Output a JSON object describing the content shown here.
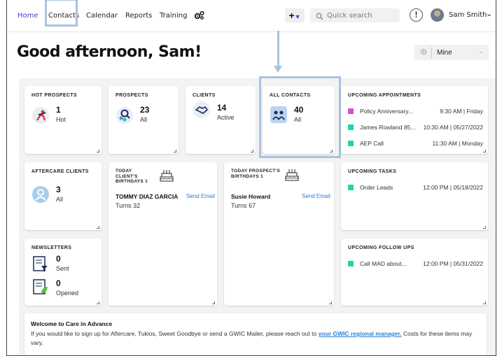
{
  "nav": {
    "items": [
      "Home",
      "Contacts",
      "Calendar",
      "Reports",
      "Training"
    ],
    "active": "Home",
    "quick_add": "+",
    "search_placeholder": "Quick search",
    "user_name": "Sam Smith",
    "accent_color": "#4a3fd1"
  },
  "greeting": "Good afternoon, Sam!",
  "filter": {
    "value": "Mine"
  },
  "stats": {
    "hot_prospects": {
      "title": "HOT PROSPECTS",
      "count": "1",
      "label": "Hot"
    },
    "prospects": {
      "title": "PROSPECTS",
      "count": "23",
      "label": "All"
    },
    "clients": {
      "title": "CLIENTS",
      "count": "14",
      "label": "Active"
    },
    "all_contacts": {
      "title": "ALL CONTACTS",
      "count": "40",
      "label": "All"
    },
    "aftercare": {
      "title": "AFTERCARE CLIENTS",
      "count": "3",
      "label": "All"
    }
  },
  "newsletters": {
    "title": "NEWSLETTERS",
    "sent_count": "0",
    "sent_label": "Sent",
    "opened_count": "0",
    "opened_label": "Opened"
  },
  "appointments": {
    "title": "UPCOMING APPOINTMENTS",
    "items": [
      {
        "name": "Policy Anniversary...",
        "when": "9:30 AM | Friday",
        "color": "#d44fd4"
      },
      {
        "name": "James Rowland 85...",
        "when": "10:30 AM | 05/27/2022",
        "color": "#1fd6a8"
      },
      {
        "name": "AEP Call",
        "when": "11:30 AM | Monday",
        "color": "#1fd6a8"
      }
    ]
  },
  "client_birthdays": {
    "title_lines": [
      "TODAY",
      "CLIENT'S",
      "BIRTHDAYS 1"
    ],
    "name": "TOMMY DIAZ GARCIA",
    "turns": "Turns 32",
    "action": "Send Email"
  },
  "prospect_birthdays": {
    "title_lines": [
      "TODAY PROSPECT'S",
      "BIRTHDAYS 1"
    ],
    "name": "Susie Howard",
    "turns": "Turns 67",
    "action": "Send Email"
  },
  "tasks": {
    "title": "UPCOMING TASKS",
    "items": [
      {
        "name": "Order Leads",
        "when": "12:00 PM | 05/18/2022",
        "color": "#1fd6a8"
      }
    ]
  },
  "followups": {
    "title": "UPCOMING FOLLOW UPS",
    "items": [
      {
        "name": "Call MAD about...",
        "when": "12:00 PM | 05/31/2022",
        "color": "#1fd6a8"
      }
    ]
  },
  "welcome": {
    "title": "Welcome to Care in Advance",
    "text_before": "If you would like to sign up for Aftercare, Tukios, Sweet Goodbye or send a GWIC Mailer, please reach out to ",
    "link": "your GWIC regional manager.",
    "text_after": " Costs for these items may vary."
  }
}
